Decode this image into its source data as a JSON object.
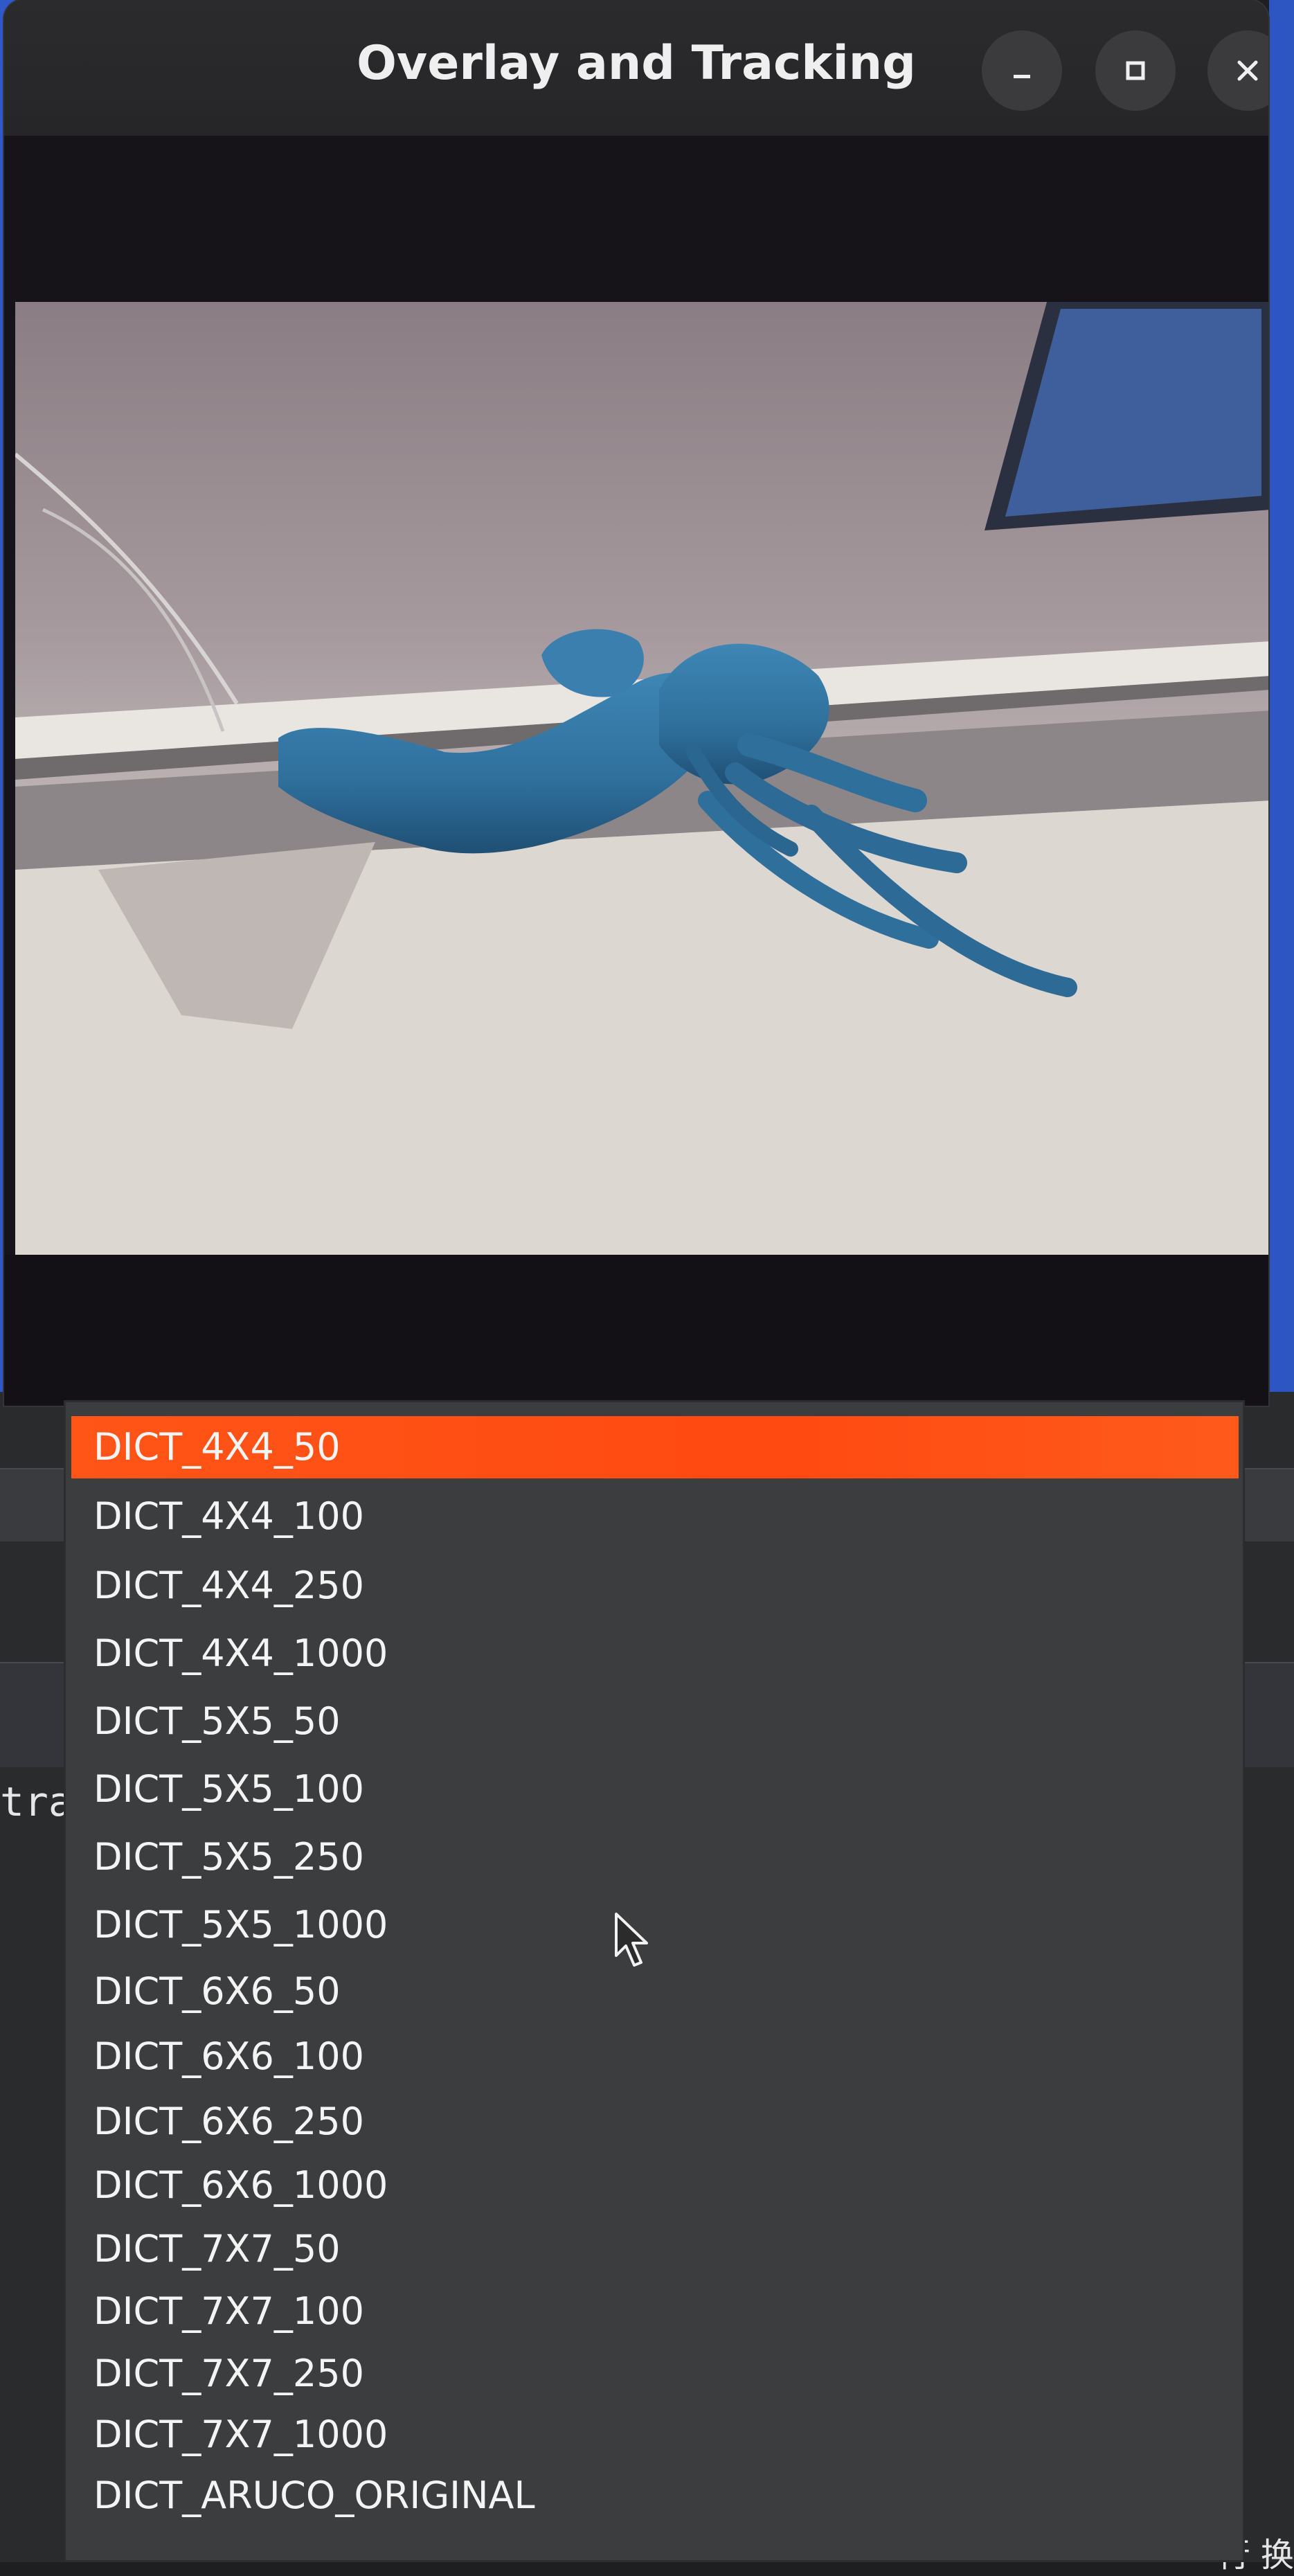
{
  "window": {
    "title": "Overlay and Tracking",
    "controls": {
      "minimize": "minimize-icon",
      "maximize": "maximize-icon",
      "close": "close-icon"
    }
  },
  "background_window": {
    "partial_text": "trac",
    "partial_cjk": "行 换"
  },
  "dropdown": {
    "selected_index": 0,
    "accent_color": "#ff5517",
    "items": [
      "DICT_4X4_50",
      "DICT_4X4_100",
      "DICT_4X4_250",
      "DICT_4X4_1000",
      "DICT_5X5_50",
      "DICT_5X5_100",
      "DICT_5X5_250",
      "DICT_5X5_1000",
      "DICT_6X6_50",
      "DICT_6X6_100",
      "DICT_6X6_250",
      "DICT_6X6_1000",
      "DICT_7X7_50",
      "DICT_7X7_100",
      "DICT_7X7_250",
      "DICT_7X7_1000",
      "DICT_ARUCO_ORIGINAL"
    ]
  }
}
